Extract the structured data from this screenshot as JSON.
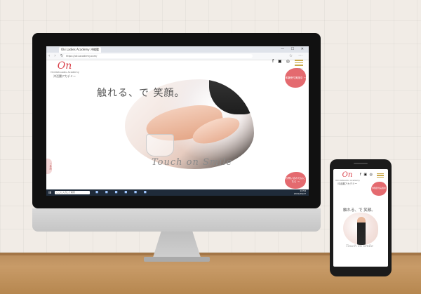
{
  "browser": {
    "tab_title": "Oki Ladies Academy 沖縄腸",
    "url": "https://oki-academy.com/",
    "window_controls": "— ☐ ✕"
  },
  "site": {
    "logo_mark": "On",
    "logo_en": "Oki-Katsuobu Academy",
    "logo_jp": "沖活腸アカデミー",
    "social_icons": [
      "facebook-icon",
      "line-icon",
      "instagram-icon"
    ],
    "social_glyphs": "f ▣ ◎",
    "menu_label": "MENU",
    "bubble_top": "体験受付実施中 → ",
    "bubble_bottom": "お問い合わせはこちら →",
    "side_tab": "ご予約",
    "headline": "触れる、で 笑顔。",
    "script_text": "Touch on Smile"
  },
  "taskbar": {
    "search_placeholder": "ここに入力して検索",
    "clock_time": "14:54",
    "clock_date": "2021/09/27"
  },
  "phone": {
    "headline": "触れる、で 笑顔。",
    "bubble": "体験受付実施中"
  }
}
